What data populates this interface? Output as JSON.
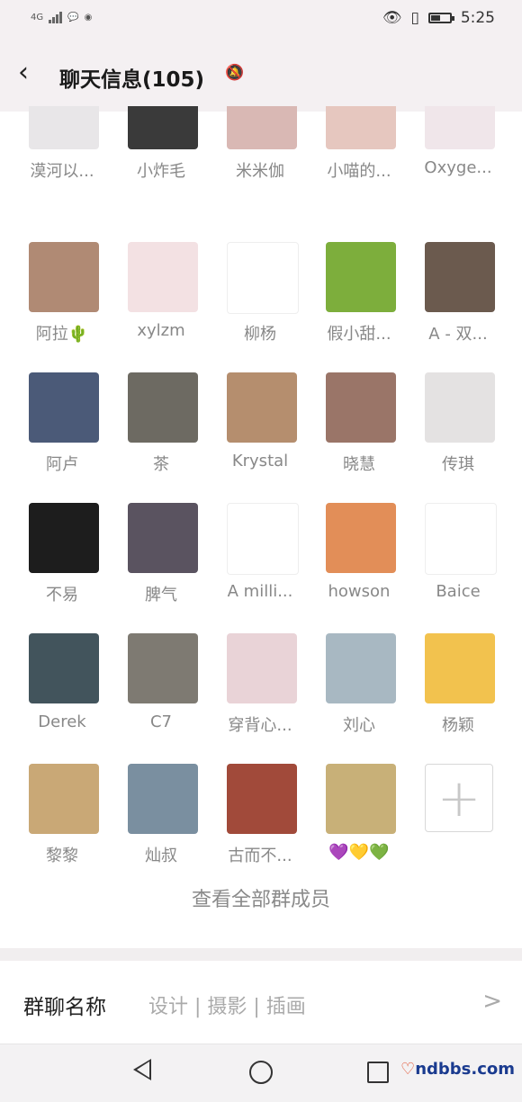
{
  "status_bar": {
    "network": "4G",
    "time": "5:25"
  },
  "header": {
    "back_icon": "chevron-left-icon",
    "title": "聊天信息(105)",
    "mute_icon": "bell-off-icon"
  },
  "members": [
    {
      "name": "漠河以...",
      "color": "#e8e6e8"
    },
    {
      "name": "小炸毛",
      "color": "#3a3a3a"
    },
    {
      "name": "米米伽",
      "color": "#d9b8b4"
    },
    {
      "name": "小喵的...",
      "color": "#e6c7bf"
    },
    {
      "name": "Oxyge...",
      "color": "#f0e6ea"
    },
    {
      "name": "阿拉🌵",
      "color": "#b08a74"
    },
    {
      "name": "xylzm",
      "color": "#f3e1e3"
    },
    {
      "name": "柳杨",
      "color": "#ffffff"
    },
    {
      "name": "假小甜...",
      "color": "#7dae3c"
    },
    {
      "name": "A - 双...",
      "color": "#6b5a4e"
    },
    {
      "name": "阿卢",
      "color": "#4b5a78"
    },
    {
      "name": "茶",
      "color": "#6d6a62"
    },
    {
      "name": "Krystal",
      "color": "#b58e6e"
    },
    {
      "name": "晓慧",
      "color": "#9a7568"
    },
    {
      "name": "传琪",
      "color": "#e4e2e2"
    },
    {
      "name": "不易",
      "color": "#1d1d1d"
    },
    {
      "name": "脾气",
      "color": "#5a5360"
    },
    {
      "name": "A milli...",
      "color": "#ffffff"
    },
    {
      "name": "howson",
      "color": "#e28e58"
    },
    {
      "name": "Baice",
      "color": "#ffffff"
    },
    {
      "name": "Derek",
      "color": "#42545c"
    },
    {
      "name": "C7",
      "color": "#7e7a72"
    },
    {
      "name": "穿背心...",
      "color": "#e9d3d7"
    },
    {
      "name": "刘心",
      "color": "#a8b8c2"
    },
    {
      "name": "杨颖",
      "color": "#f2c24e"
    },
    {
      "name": "黎黎",
      "color": "#c9a876"
    },
    {
      "name": "灿叔",
      "color": "#7a8fa0"
    },
    {
      "name": "古而不...",
      "color": "#a14a3a"
    },
    {
      "name": "💜💛💚",
      "color": "#c8b078"
    }
  ],
  "add_button": {
    "label": "+"
  },
  "view_all": "查看全部群成员",
  "group_name": {
    "label": "群聊名称",
    "value": "设计 | 摄影 | 插画",
    "chevron": ">"
  },
  "watermark": {
    "brand_hi": "♡",
    "brand": "ndbbs.com"
  }
}
